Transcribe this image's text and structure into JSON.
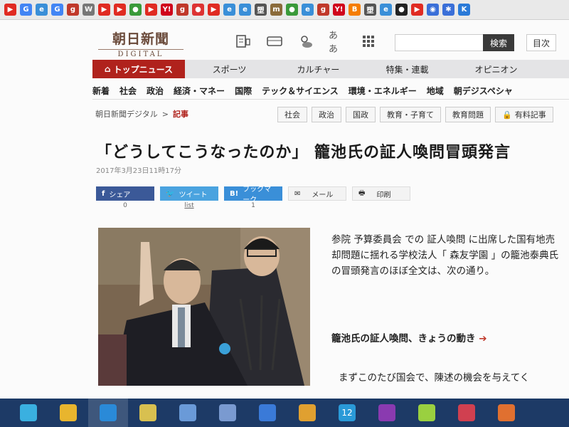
{
  "bookmarks": [
    {
      "icon": "youtube-icon",
      "color": "#e02b22",
      "glyph": "▶"
    },
    {
      "icon": "google-icon",
      "color": "#4285f4",
      "glyph": "G"
    },
    {
      "icon": "page-icon",
      "color": "#3a8fd8",
      "glyph": "e"
    },
    {
      "icon": "google-icon",
      "color": "#4285f4",
      "glyph": "G"
    },
    {
      "icon": "goo-icon",
      "color": "#c0392b",
      "glyph": "g"
    },
    {
      "icon": "wikipedia-icon",
      "color": "#777",
      "glyph": "W"
    },
    {
      "icon": "youtube-icon",
      "color": "#e02b22",
      "glyph": "▶"
    },
    {
      "icon": "youtube-icon",
      "color": "#e02b22",
      "glyph": "▶"
    },
    {
      "icon": "frog-icon",
      "color": "#3a9a3a",
      "glyph": "●"
    },
    {
      "icon": "youtube-icon",
      "color": "#e02b22",
      "glyph": "▶"
    },
    {
      "icon": "yahoo-icon",
      "color": "#d0021b",
      "glyph": "Y!"
    },
    {
      "icon": "goo-icon",
      "color": "#c0392b",
      "glyph": "g"
    },
    {
      "icon": "record-icon",
      "color": "#d33",
      "glyph": "●"
    },
    {
      "icon": "youtube-icon",
      "color": "#e02b22",
      "glyph": "▶"
    },
    {
      "icon": "page-icon",
      "color": "#3a8fd8",
      "glyph": "e"
    },
    {
      "icon": "page-icon",
      "color": "#3a8fd8",
      "glyph": "e"
    },
    {
      "icon": "dictionary-icon",
      "color": "#555",
      "glyph": "塑"
    },
    {
      "icon": "m-icon",
      "color": "#8a6a3a",
      "glyph": "m"
    },
    {
      "icon": "frog-icon",
      "color": "#3a9a3a",
      "glyph": "●"
    },
    {
      "icon": "page-icon",
      "color": "#3a8fd8",
      "glyph": "e"
    },
    {
      "icon": "goo-icon",
      "color": "#c0392b",
      "glyph": "g"
    },
    {
      "icon": "yahoo-icon",
      "color": "#d0021b",
      "glyph": "Y!"
    },
    {
      "icon": "blogger-icon",
      "color": "#f57d00",
      "glyph": "B"
    },
    {
      "icon": "dictionary-icon",
      "color": "#555",
      "glyph": "塑"
    },
    {
      "icon": "page-icon",
      "color": "#3a8fd8",
      "glyph": "e"
    },
    {
      "icon": "circle-icon",
      "color": "#222",
      "glyph": "●"
    },
    {
      "icon": "youtube-icon",
      "color": "#e02b22",
      "glyph": "▶"
    },
    {
      "icon": "eye-icon",
      "color": "#3a6fd8",
      "glyph": "◉"
    },
    {
      "icon": "tools-icon",
      "color": "#3a6fd8",
      "glyph": "✱"
    },
    {
      "icon": "k-icon",
      "color": "#2a7ad8",
      "glyph": "K"
    }
  ],
  "header": {
    "logo_jp": "朝日新聞",
    "logo_en": "DIGITAL",
    "aa_label": "ああ",
    "search_button": "検索",
    "toc_button": "目次"
  },
  "nav_primary": [
    "トップニュース",
    "スポーツ",
    "カルチャー",
    "特集・連載",
    "オピニオン"
  ],
  "nav_secondary": [
    "新着",
    "社会",
    "政治",
    "経済・マネー",
    "国際",
    "テック＆サイエンス",
    "環境・エネルギー",
    "地域",
    "朝デジスペシャ"
  ],
  "breadcrumb": {
    "site": "朝日新聞デジタル",
    "sep": ">",
    "current": "記事"
  },
  "tags": [
    "社会",
    "政治",
    "国政",
    "教育・子育て",
    "教育問題",
    "有料記事"
  ],
  "article": {
    "title": "「どうしてこうなったのか」 籠池氏の証人喚問冒頭発言",
    "date": "2017年3月23日11時17分",
    "share": {
      "facebook": "シェア",
      "twitter": "ツイート",
      "hatena": "ブックマーク",
      "mail": "メール",
      "print": "印刷",
      "facebook_count": "0",
      "twitter_count": "list",
      "hatena_count": "1"
    },
    "lead": "参院 予算委員会 での 証人喚問 に出席した国有地売却問題に揺れる学校法人「 森友学園 」の籠池泰典氏の冒頭発言のほぼ全文は、次の通り。",
    "related": "籠池氏の証人喚問、きょうの動き",
    "body": "まずこのたび国会で、陳述の機会を与えてく"
  },
  "taskbar": [
    {
      "icon": "snipping-tool-icon",
      "color": "#3ab0e0"
    },
    {
      "icon": "chrome-icon",
      "color": "#e8b52e"
    },
    {
      "icon": "internet-explorer-icon",
      "color": "#2a8ad8"
    },
    {
      "icon": "photo-icon",
      "color": "#d8c050"
    },
    {
      "icon": "paint-icon",
      "color": "#6a9ad8"
    },
    {
      "icon": "butterfly-icon",
      "color": "#7a9ad0"
    },
    {
      "icon": "onedrive-icon",
      "color": "#3a7ad8"
    },
    {
      "icon": "photos-icon",
      "color": "#e0a030"
    },
    {
      "icon": "calendar-icon",
      "color": "#2a9ad8"
    },
    {
      "icon": "onenote-icon",
      "color": "#8a3ab0"
    },
    {
      "icon": "sticky-notes-icon",
      "color": "#9ad040"
    },
    {
      "icon": "app-icon",
      "color": "#d04050"
    },
    {
      "icon": "app-icon",
      "color": "#e07030"
    }
  ],
  "taskbar_calendar_day": "12"
}
